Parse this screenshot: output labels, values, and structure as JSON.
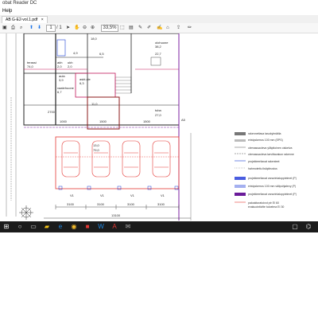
{
  "window": {
    "title_fragment": "obat Reader DC"
  },
  "menu": {
    "help": "Help"
  },
  "tab": {
    "label": "AB G-E2-vol.1.pdf"
  },
  "toolbar": {
    "page_current": "1",
    "page_total": "/ 1",
    "zoom": "33,5%"
  },
  "plan": {
    "rooms": [
      {
        "name": "terassi",
        "area": "74,0"
      },
      {
        "name": "",
        "area": "18,0"
      },
      {
        "name": "",
        "area": "4,9"
      },
      {
        "name": "",
        "area": "6,5"
      },
      {
        "name": "olohuone",
        "area": "38,2"
      },
      {
        "name": "",
        "area": "22,7"
      },
      {
        "name": "akh",
        "area": "2,0"
      },
      {
        "name": "ukh",
        "area": "2,0"
      },
      {
        "name": "aula",
        "area": "3,9"
      },
      {
        "name": "vaatehuone",
        "area": "6,7"
      },
      {
        "name": "askt.aie",
        "area": "6,3"
      },
      {
        "name": "",
        "area": "11,0"
      },
      {
        "name": "tuba",
        "area": "27,0"
      },
      {
        "name": "",
        "area": "13,0"
      },
      {
        "name": "",
        "area": "79,0"
      }
    ],
    "dimensions": [
      "3100",
      "3100",
      "3100",
      "3100",
      "13100"
    ],
    "misc_labels": [
      "1000",
      "1500",
      "1500",
      "V1",
      "V1",
      "V1",
      "V1",
      "A5",
      "2700"
    ]
  },
  "legend": [
    "rakennettava tasokylmätila",
    "eristyskerros 100 mm (EPS)",
    "olemassaoleva ylläpitoinen oiskelva",
    "olemassaoleva tarvittavakon rakenne",
    "projekteeritavat rakenteet",
    "hahmotettu lisäpiirustus",
    "projekteeritavat vanorintaloppielmet (P)",
    "eristyskerros 100 mm välipohjalevy (P)",
    "projekteeritavat vanorintaloppielmet (P)",
    "paloaktoratoivot ptr EI 60",
    "evakuointiviite tuloelma EI 30"
  ]
}
